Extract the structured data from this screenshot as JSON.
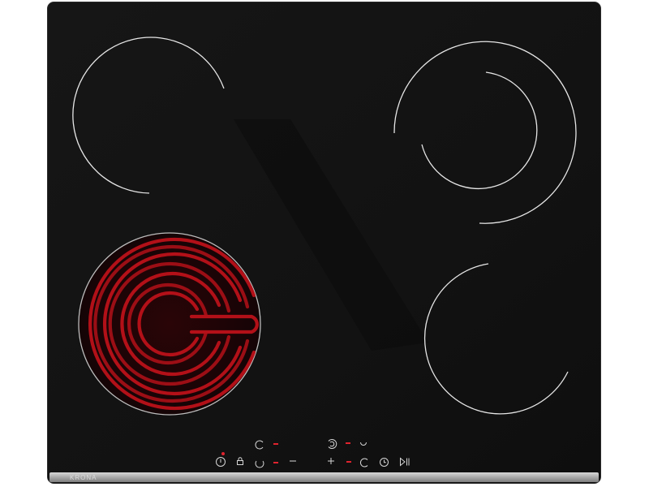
{
  "product": {
    "brand": "KRONA"
  },
  "zones": [
    {
      "id": "front-left",
      "state": "heating",
      "heating_color": "#c0121a"
    },
    {
      "id": "rear-left",
      "state": "off"
    },
    {
      "id": "rear-right",
      "state": "off",
      "type": "dual-ring"
    },
    {
      "id": "front-right",
      "state": "off"
    }
  ],
  "controls": [
    {
      "name": "power",
      "icon": "power-icon",
      "indicator": "red-dot"
    },
    {
      "name": "lock",
      "icon": "lock-icon"
    },
    {
      "name": "zone-selector",
      "icon": "ring-zone-icon"
    },
    {
      "name": "minus",
      "icon": "minus-icon"
    },
    {
      "name": "plus",
      "icon": "plus-icon"
    },
    {
      "name": "dual-zone",
      "icon": "dual-ring-icon"
    },
    {
      "name": "timer",
      "icon": "clock-icon"
    },
    {
      "name": "play-pause",
      "icon": "play-pause-icon"
    }
  ],
  "colors": {
    "glass": "#121212",
    "ring_outline": "#e6e6e6",
    "indicator_red": "#e0232e",
    "trim": "#b8b8b8"
  }
}
